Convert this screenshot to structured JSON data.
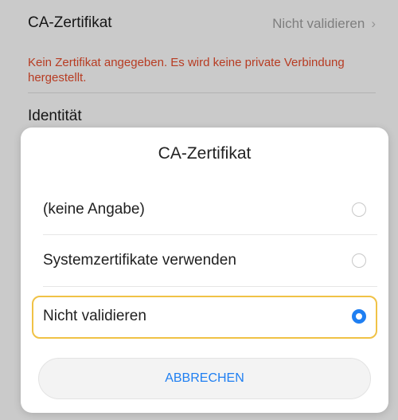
{
  "settings": {
    "ca_certificate_label": "CA-Zertifikat",
    "ca_certificate_value": "Nicht validieren",
    "chevron": "›",
    "warning_text": "Kein Zertifikat angegeben. Es wird keine private Verbindung hergestellt.",
    "identity_label": "Identität"
  },
  "dialog": {
    "title": "CA-Zertifikat",
    "options": [
      {
        "label": "(keine Angabe)",
        "selected": false
      },
      {
        "label": "Systemzertifikate verwenden",
        "selected": false
      },
      {
        "label": "Nicht validieren",
        "selected": true
      }
    ],
    "cancel_label": "ABBRECHEN"
  },
  "colors": {
    "accent": "#1f7ff2",
    "warning": "#e04a2b",
    "highlight": "#f0c246"
  }
}
